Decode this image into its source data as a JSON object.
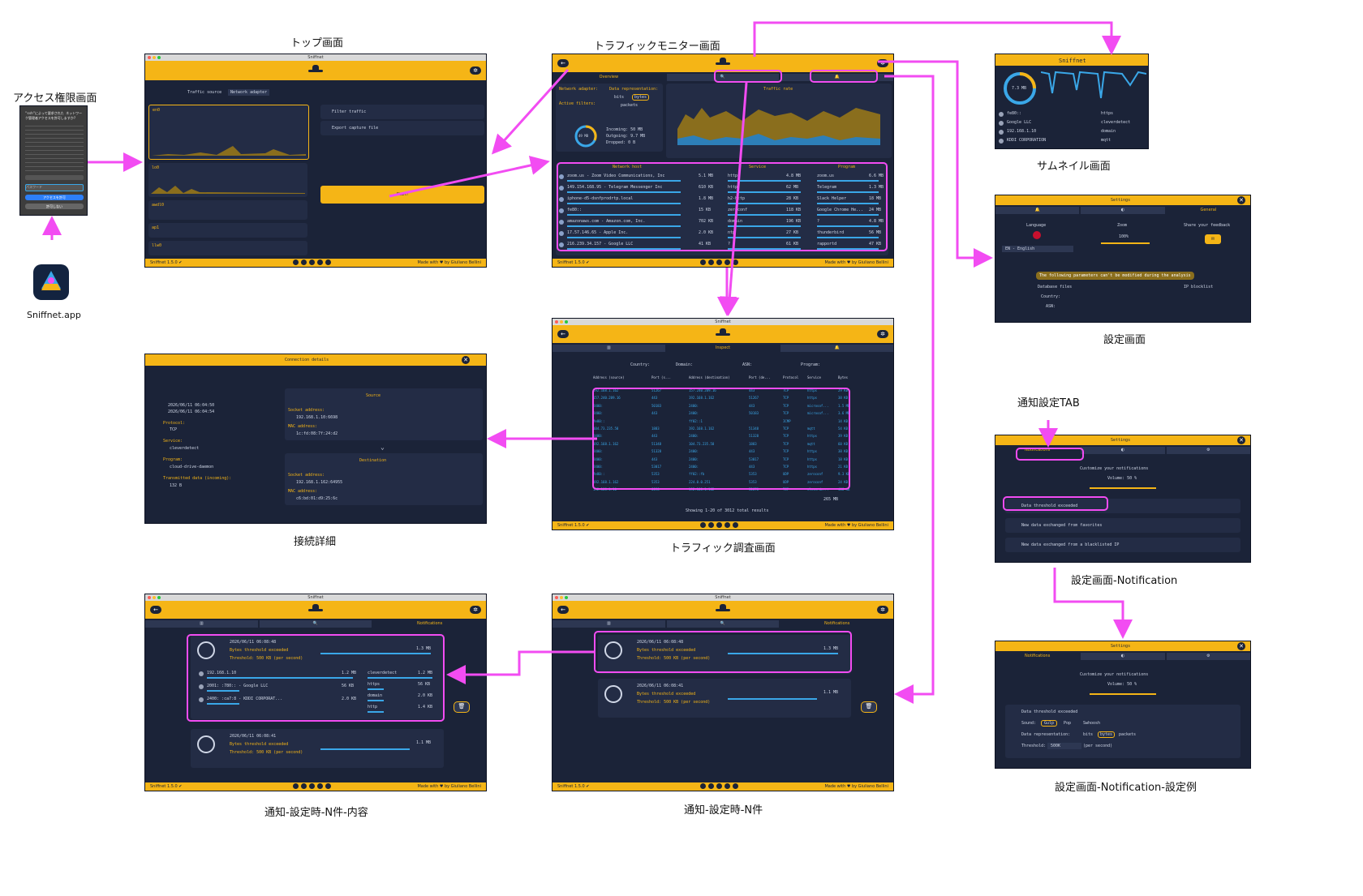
{
  "captions": {
    "access": "アクセス権限画面",
    "top": "トップ画面",
    "monitor": "トラフィックモニター画面",
    "thumbnail": "サムネイル画面",
    "settings": "設定画面",
    "notify_tab": "通知設定TAB",
    "settings_notification": "設定画面-Notification",
    "settings_notification_example": "設定画面-Notification-設定例",
    "connection_detail": "接続詳細",
    "inspect": "トラフィック調査画面",
    "notify_n_detail": "通知-設定時-N件-内容",
    "notify_n": "通知-設定時-N件",
    "app_name": "Sniffnet.app"
  },
  "app": {
    "title": "Sniffnet",
    "version": "Sniffnet 1.5.0 ✔",
    "made_with": "Made with ♥ by Giuliano Bellini"
  },
  "access_screen": {
    "prompt": "\"ssh\"によって要求された ネットワーク管理者アクセスを許可しますか?",
    "allow": "アクセスを許可",
    "deny": "許可しない",
    "password": "パスワード"
  },
  "top_screen": {
    "traffic_source": "Traffic source",
    "network_adapter": "Network adapter",
    "adapters": [
      "en0",
      "lo0",
      "awdl0",
      "ap1",
      "llw0"
    ],
    "filter_traffic": "Filter traffic",
    "export_capture": "Export capture file",
    "start": "Start!"
  },
  "monitor_screen": {
    "overview": "Overview",
    "traffic_rate": "Traffic rate",
    "network_adapter": "Network adapter:",
    "data_representation": "Data representation:",
    "bits": "bits",
    "bytes": "bytes",
    "packets": "packets",
    "active_filters": "Active filters:",
    "total": "49 MB",
    "incoming": "Incoming: 50 MB",
    "outgoing": "Outgoing: 9.7 MB",
    "dropped": "Dropped: 0 B",
    "col_host": "Network host",
    "col_service": "Service",
    "col_program": "Program",
    "hosts": [
      {
        "name": "zoom.us - Zoom Video Communications, Inc",
        "val": "5.1 MB"
      },
      {
        "name": "149.154.168.95 - Telegram Messenger Inc",
        "val": "610 KB"
      },
      {
        "name": "iphone-d5-dsnfprodrtp.local",
        "val": "1.8 MB"
      },
      {
        "name": "fe80::",
        "val": "15 KB"
      },
      {
        "name": "amazonaws.com - Amazon.com, Inc.",
        "val": "702 KB"
      },
      {
        "name": "17.57.146.65 - Apple Inc.",
        "val": "2.0 KB"
      },
      {
        "name": "216.239.34.157 - Google LLC",
        "val": "41 KB"
      }
    ],
    "services": [
      {
        "name": "https",
        "val": "4.8 MB"
      },
      {
        "name": "http",
        "val": "62 MB"
      },
      {
        "name": "h2-http",
        "val": "28 KB"
      },
      {
        "name": "zeroconf",
        "val": "118 KB"
      },
      {
        "name": "domain",
        "val": "196 KB"
      },
      {
        "name": "ntp",
        "val": "27 KB"
      },
      {
        "name": "?",
        "val": "61 KB"
      }
    ],
    "programs": [
      {
        "name": "zoom.us",
        "val": "6.6 MB"
      },
      {
        "name": "Telegram",
        "val": "1.3 MB"
      },
      {
        "name": "Slack Helper",
        "val": "18 MB"
      },
      {
        "name": "Google Chrome He...",
        "val": "24 MB"
      },
      {
        "name": "?",
        "val": "4.8 MB"
      },
      {
        "name": "thunderbird",
        "val": "56 MB"
      },
      {
        "name": "rapportd",
        "val": "47 KB"
      }
    ]
  },
  "thumbnail": {
    "title": "Sniffnet",
    "total": "7.3 MB",
    "hosts": [
      "fe80::",
      "Google LLC",
      "192.168.1.10",
      "KDDI CORPORATION"
    ],
    "services": [
      "https",
      "cleverdetect",
      "domain",
      "mqtt"
    ]
  },
  "settings_general": {
    "title": "Settings",
    "tab": "General",
    "language": "Language",
    "language_value": "EN - English",
    "zoom": "Zoom",
    "zoom_value": "100%",
    "feedback": "Share your feedback",
    "warning": "The following parameters can't be modified during the analysis",
    "database_files": "Database files",
    "country": "Country:",
    "asn": "ASN:",
    "ip_blocklist": "IP blocklist"
  },
  "settings_notification": {
    "title": "Settings",
    "tab": "Notifications",
    "customize": "Customize your notifications",
    "volume": "Volume: 50 %",
    "item1": "Data threshold exceeded",
    "item2": "New data exchanged from favorites",
    "item3": "New data exchanged from a blacklisted IP"
  },
  "settings_notification_example": {
    "sound": "Sound:",
    "sounds": [
      "Gulp",
      "Pop",
      "Swhoosh"
    ],
    "data_repr": "Data representation:",
    "threshold": "Threshold:",
    "threshold_value": "500K",
    "per_second": "(per second)"
  },
  "connection_details": {
    "title": "Connection details",
    "time1": "2026/06/11 06:04:50",
    "time2": "2026/06/11 06:04:54",
    "protocol_label": "Protocol:",
    "protocol": "TCP",
    "service_label": "Service:",
    "service": "cleverdetect",
    "program_label": "Program:",
    "program": "cloud-drive-daemon",
    "transmitted_label": "Transmitted data (incoming):",
    "transmitted": "132 B",
    "source": "Source",
    "destination": "Destination",
    "socket_label": "Socket address:",
    "src_socket": "192.168.1.10:6698",
    "src_mac_label": "MAC address:",
    "src_mac": "1c:fd:08:7f:24:d2",
    "dst_socket": "192.168.1.162:64955",
    "dst_mac": "c6:bd:01:d9:25:6c"
  },
  "inspect_screen": {
    "tab": "Inspect",
    "country": "Country:",
    "domain": "Domain:",
    "asn": "ASN:",
    "program": "Program:",
    "cols": [
      "Address (source)",
      "Port (s...",
      "Address (destination)",
      "Port (de...",
      "Protocol",
      "Service",
      "Bytes"
    ],
    "rows": [
      [
        "192.168.1.162",
        "51267",
        "157.240.209.16",
        "443",
        "TCP",
        "https",
        "29 KB"
      ],
      [
        "157.240.209.16",
        "443",
        "192.168.1.162",
        "51267",
        "TCP",
        "https",
        "38 KB"
      ],
      [
        "2400:",
        "50183",
        "2400:",
        "443",
        "TCP",
        "microsof...",
        "1.5 MB"
      ],
      [
        "2400:",
        "443",
        "2400:",
        "50183",
        "TCP",
        "microsof...",
        "3.6 MB"
      ],
      [
        "fe80::",
        "",
        "ff02::1",
        "",
        "ICMP",
        "",
        "14 KB"
      ],
      [
        "104.73.235.58",
        "1883",
        "192.168.1.162",
        "51348",
        "TCP",
        "mqtt",
        "54 KB"
      ],
      [
        "2400:",
        "443",
        "2400:",
        "51328",
        "TCP",
        "https",
        "39 KB"
      ],
      [
        "192.168.1.162",
        "51348",
        "104.73.235.58",
        "1883",
        "TCP",
        "mqtt",
        "60 KB"
      ],
      [
        "2400:",
        "51328",
        "2400:",
        "443",
        "TCP",
        "https",
        "38 KB"
      ],
      [
        "2400:",
        "443",
        "2400:",
        "53017",
        "TCP",
        "https",
        "18 KB"
      ],
      [
        "2400:",
        "53017",
        "2400:",
        "443",
        "TCP",
        "https",
        "21 KB"
      ],
      [
        "fe80::",
        "5353",
        "ff02::fb",
        "5353",
        "UDP",
        "zeroconf",
        "9.3 KB"
      ],
      [
        "192.168.1.162",
        "5353",
        "224.0.0.251",
        "5353",
        "UDP",
        "zeroconf",
        "24 KB"
      ],
      [
        "192.168.1.10",
        "6698",
        "192.168.1.162",
        "52678",
        "TCP",
        "cleverde...",
        "488 KB"
      ]
    ],
    "total_bytes": "265 MB",
    "showing": "Showing 1-20 of 3012 total results"
  },
  "notifications": {
    "tab": "Notifications",
    "n1_time": "2026/06/11 06:08:48",
    "n1_title": "Bytes threshold exceeded",
    "n1_threshold": "Threshold: 500 KB (per second)",
    "n1_value": "1.3 MB",
    "n2_time": "2026/06/11 06:08:41",
    "n2_title": "Bytes threshold exceeded",
    "n2_threshold": "Threshold: 500 KB (per second)",
    "n2_value": "1.1 MB",
    "detail_hosts": [
      {
        "name": "192.168.1.10",
        "val": "1.2 MB"
      },
      {
        "name": "2001:   :780:: - Google LLC",
        "val": "56 KB"
      },
      {
        "name": "2400:   :ca7:8 - KDDI CORPORAT...",
        "val": "2.0 KB"
      }
    ],
    "detail_services": [
      {
        "name": "cleverdetect",
        "val": "1.2 MB"
      },
      {
        "name": "https",
        "val": "56 KB"
      },
      {
        "name": "domain",
        "val": "2.0 KB"
      },
      {
        "name": "http",
        "val": "1.4 KB"
      }
    ]
  },
  "colors": {
    "accent": "#f5b516",
    "background": "#1b2338",
    "arrow": "#f24cf2"
  }
}
